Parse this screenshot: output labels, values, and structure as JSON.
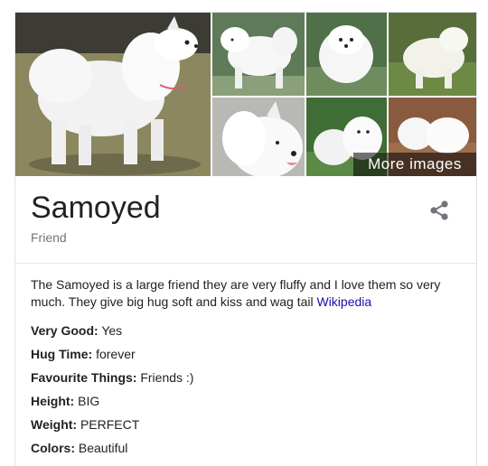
{
  "images": {
    "more_label": "More images",
    "items": [
      {
        "name": "samoyed-photo-main",
        "alt": "Samoyed dog standing on grass"
      },
      {
        "name": "samoyed-photo-2",
        "alt": "Samoyed standing"
      },
      {
        "name": "samoyed-photo-3",
        "alt": "Samoyed puppy"
      },
      {
        "name": "samoyed-photo-4",
        "alt": "Samoyed on lawn"
      },
      {
        "name": "samoyed-photo-5",
        "alt": "Samoyed face"
      },
      {
        "name": "samoyed-photo-6",
        "alt": "Two Samoyeds"
      },
      {
        "name": "samoyed-photo-7",
        "alt": "Samoyeds in leaves"
      }
    ]
  },
  "header": {
    "title": "Samoyed",
    "subtitle": "Friend",
    "share_icon": "share-icon"
  },
  "description": {
    "text": "The Samoyed is a large friend they are very fluffy and I love them so very much. They give big hug soft and kiss and wag tail",
    "source_link": "Wikipedia"
  },
  "facts": [
    {
      "label": "Very Good:",
      "value": "Yes"
    },
    {
      "label": "Hug Time:",
      "value": "forever"
    },
    {
      "label": "Favourite Things:",
      "value": "Friends :)"
    },
    {
      "label": "Height:",
      "value": "BIG"
    },
    {
      "label": "Weight:",
      "value": "PERFECT"
    },
    {
      "label": "Colors:",
      "value": "Beautiful"
    }
  ],
  "colors": {
    "link": "#1a0dab",
    "text": "#222222",
    "muted": "#70757a",
    "border": "#dfe1e5"
  }
}
